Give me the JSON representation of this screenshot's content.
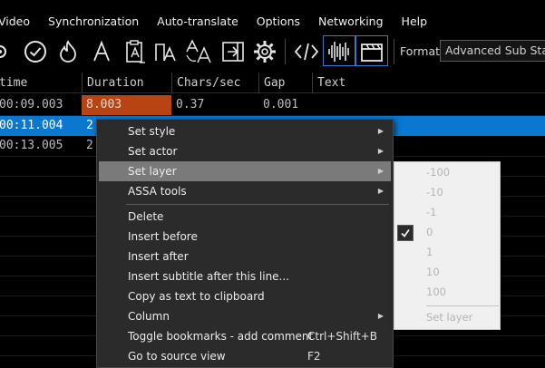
{
  "menubar": {
    "items": [
      "Video",
      "Synchronization",
      "Auto-translate",
      "Options",
      "Networking",
      "Help"
    ]
  },
  "toolbar": {
    "icons": [
      "settings-partial-icon",
      "check-circle-icon",
      "flame-icon",
      "font-letter-icon",
      "clipboard-text-icon",
      "clipboard-letters-icon",
      "translate-letters-icon",
      "import-arrow-icon",
      "gear-icon",
      "source-code-icon",
      "waveform-icon",
      "clapperboard-icon"
    ],
    "format_label": "Format",
    "format_value": "Advanced Sub Station Alpha"
  },
  "grid": {
    "columns": [
      " time",
      "Duration",
      "Chars/sec",
      "Gap",
      "Text"
    ],
    "rows": [
      {
        "time": "00:09.003",
        "duration": "8.003",
        "cps": "0.37",
        "gap": "0.001",
        "text": ""
      },
      {
        "time": "00:11.004",
        "duration": "2",
        "cps": "",
        "gap": "",
        "text": ""
      },
      {
        "time": "00:13.005",
        "duration": "2",
        "cps": "",
        "gap": "",
        "text": ""
      }
    ]
  },
  "context_menu": {
    "items": [
      {
        "label": "Set style",
        "shortcut": "",
        "submenu": true
      },
      {
        "label": "Set actor",
        "shortcut": "",
        "submenu": true
      },
      {
        "label": "Set layer",
        "shortcut": "",
        "submenu": true
      },
      {
        "label": "ASSA tools",
        "shortcut": "",
        "submenu": true
      },
      {
        "label": "Delete",
        "shortcut": "",
        "submenu": false
      },
      {
        "label": "Insert before",
        "shortcut": "",
        "submenu": false
      },
      {
        "label": "Insert after",
        "shortcut": "",
        "submenu": false
      },
      {
        "label": "Insert subtitle after this line...",
        "shortcut": "",
        "submenu": false
      },
      {
        "label": "Copy as text to clipboard",
        "shortcut": "",
        "submenu": false
      },
      {
        "label": "Column",
        "shortcut": "",
        "submenu": true
      },
      {
        "label": "Toggle bookmarks - add comment",
        "shortcut": "Ctrl+Shift+B",
        "submenu": false
      },
      {
        "label": "Go to source view",
        "shortcut": "F2",
        "submenu": false
      }
    ]
  },
  "layer_submenu": {
    "items": [
      "-100",
      "-10",
      "-1",
      "0",
      "1",
      "10",
      "100"
    ],
    "checked_value": "0",
    "set_layer_label": "Set layer"
  },
  "colors": {
    "selection": "#0a78d0",
    "warning_cell": "#b84414",
    "menu_bg": "#2b2b2b",
    "menu_hover": "#7a7a7a",
    "toolbar_highlight": "#3b79c4"
  }
}
